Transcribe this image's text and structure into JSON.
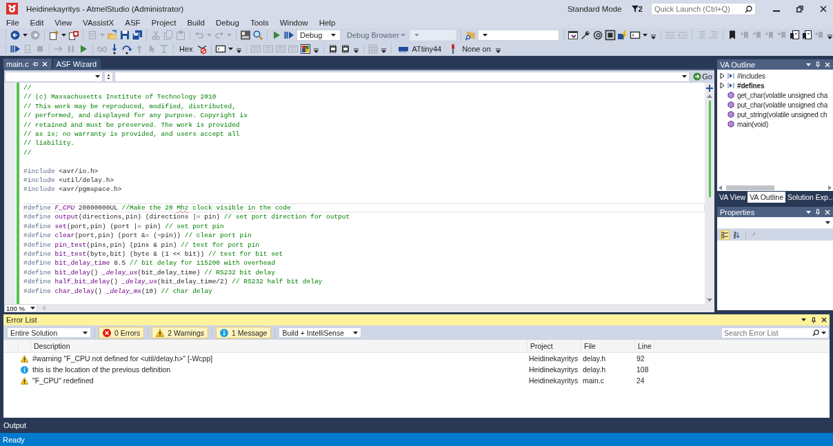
{
  "window": {
    "title": "Heidinekayritys - AtmelStudio (Administrator)",
    "mode": "Standard Mode",
    "notification_count": "2",
    "quick_launch": {
      "placeholder": "Quick Launch (Ctrl+Q)"
    }
  },
  "menu": [
    "File",
    "Edit",
    "View",
    "VAssistX",
    "ASF",
    "Project",
    "Build",
    "Debug",
    "Tools",
    "Window",
    "Help"
  ],
  "toolbar": {
    "dropdowns": [
      {
        "value": "Debug",
        "disabled": false
      },
      {
        "value": "Debug Browser",
        "disabled": true
      },
      {
        "disabled": true
      },
      {
        "disabled": false
      }
    ],
    "hex_label": "Hex",
    "device": "ATtiny44",
    "tool": "None on"
  },
  "editor": {
    "tabs": [
      {
        "label": "main.c",
        "selected": true
      },
      {
        "label": "ASF Wizard",
        "selected": false
      }
    ],
    "go_label": "Go",
    "zoom": "100 %",
    "lines": [
      {
        "current": false,
        "segments": [
          {
            "kind": "comment",
            "text": "//"
          }
        ]
      },
      {
        "current": false,
        "segments": [
          {
            "kind": "comment",
            "text": "// (c) Massachusetts Institute of Technology 2010"
          }
        ]
      },
      {
        "current": false,
        "segments": [
          {
            "kind": "comment",
            "text": "// This work may be reproduced, modified, distributed,"
          }
        ]
      },
      {
        "current": false,
        "segments": [
          {
            "kind": "comment",
            "text": "// performed, and displayed for any purpose. Copyright is"
          }
        ]
      },
      {
        "current": false,
        "segments": [
          {
            "kind": "comment",
            "text": "// retained and must be preserved. The work is provided"
          }
        ]
      },
      {
        "current": false,
        "segments": [
          {
            "kind": "comment",
            "text": "// as is; no warranty is provided, and users accept all"
          }
        ]
      },
      {
        "current": false,
        "segments": [
          {
            "kind": "comment",
            "text": "// liability."
          }
        ]
      },
      {
        "current": false,
        "segments": [
          {
            "kind": "comment",
            "text": "//"
          }
        ]
      },
      {
        "current": false
      },
      {
        "current": false,
        "segments": [
          {
            "kind": "directive",
            "text": "#include"
          },
          {
            "kind": "text",
            "text": " <avr/io.h>"
          }
        ]
      },
      {
        "current": false,
        "segments": [
          {
            "kind": "directive",
            "text": "#include"
          },
          {
            "kind": "text",
            "text": " <util/delay.h>"
          }
        ]
      },
      {
        "current": false,
        "segments": [
          {
            "kind": "directive",
            "text": "#include"
          },
          {
            "kind": "text",
            "text": " <avr/pgmspace.h>"
          }
        ]
      },
      {
        "current": false
      },
      {
        "current": true,
        "segments": [
          {
            "kind": "directive",
            "text": "#define "
          },
          {
            "kind": "macro-italic",
            "text": "F_CPU"
          },
          {
            "kind": "text",
            "text": " 20000000UL "
          },
          {
            "kind": "comment",
            "text": "//Make the 20 "
          },
          {
            "kind": "misspelled",
            "text": "Mhz"
          },
          {
            "kind": "comment",
            "text": " clock visible in the code"
          }
        ]
      },
      {
        "current": false,
        "segments": [
          {
            "kind": "directive",
            "text": "#define "
          },
          {
            "kind": "macro",
            "text": "output"
          },
          {
            "kind": "text",
            "text": "(directions,pin) (directions |= pin) "
          },
          {
            "kind": "comment",
            "text": "// set port direction for output"
          }
        ]
      },
      {
        "current": false,
        "segments": [
          {
            "kind": "directive",
            "text": "#define "
          },
          {
            "kind": "macro",
            "text": "set"
          },
          {
            "kind": "text",
            "text": "(port,pin) (port |= pin) "
          },
          {
            "kind": "comment",
            "text": "// set port pin"
          }
        ]
      },
      {
        "current": false,
        "segments": [
          {
            "kind": "directive",
            "text": "#define "
          },
          {
            "kind": "macro",
            "text": "clear"
          },
          {
            "kind": "text",
            "text": "(port,pin) (port &= (~pin)) "
          },
          {
            "kind": "comment",
            "text": "// clear port pin"
          }
        ]
      },
      {
        "current": false,
        "segments": [
          {
            "kind": "directive",
            "text": "#define "
          },
          {
            "kind": "macro",
            "text": "pin_test"
          },
          {
            "kind": "text",
            "text": "(pins,pin) (pins & pin) "
          },
          {
            "kind": "comment",
            "text": "// test for port pin"
          }
        ]
      },
      {
        "current": false,
        "segments": [
          {
            "kind": "directive",
            "text": "#define "
          },
          {
            "kind": "macro",
            "text": "bit_test"
          },
          {
            "kind": "text",
            "text": "(byte,bit) (byte & (1 << bit)) "
          },
          {
            "kind": "comment",
            "text": "// test for bit set"
          }
        ]
      },
      {
        "current": false,
        "segments": [
          {
            "kind": "directive",
            "text": "#define "
          },
          {
            "kind": "macro",
            "text": "bit_delay_time"
          },
          {
            "kind": "text",
            "text": " 8.5 "
          },
          {
            "kind": "comment",
            "text": "// bit delay for 115200 with overhead"
          }
        ]
      },
      {
        "current": false,
        "segments": [
          {
            "kind": "directive",
            "text": "#define "
          },
          {
            "kind": "macro",
            "text": "bit_delay"
          },
          {
            "kind": "text",
            "text": "() "
          },
          {
            "kind": "macro-italic",
            "text": "_delay_us"
          },
          {
            "kind": "text",
            "text": "(bit_delay_time) "
          },
          {
            "kind": "comment",
            "text": "// RS232 bit delay"
          }
        ]
      },
      {
        "current": false,
        "segments": [
          {
            "kind": "directive",
            "text": "#define "
          },
          {
            "kind": "macro",
            "text": "half_bit_delay"
          },
          {
            "kind": "text",
            "text": "() "
          },
          {
            "kind": "macro-italic",
            "text": "_delay_us"
          },
          {
            "kind": "text",
            "text": "(bit_delay_time/2) "
          },
          {
            "kind": "comment",
            "text": "// RS232 half bit delay"
          }
        ]
      },
      {
        "current": false,
        "segments": [
          {
            "kind": "directive",
            "text": "#define "
          },
          {
            "kind": "macro",
            "text": "char_delay"
          },
          {
            "kind": "text",
            "text": "() "
          },
          {
            "kind": "macro-italic",
            "text": "_delay_ms"
          },
          {
            "kind": "text",
            "text": "(10) "
          },
          {
            "kind": "comment",
            "text": "// char delay"
          }
        ]
      }
    ]
  },
  "va_outline": {
    "title": "VA Outline",
    "items": [
      {
        "kind": "group",
        "label": "#includes",
        "expanded": false,
        "bold": false
      },
      {
        "kind": "group",
        "label": "#defines",
        "expanded": false,
        "bold": true
      },
      {
        "kind": "function",
        "label": "get_char(volatile unsigned cha",
        "bold": false
      },
      {
        "kind": "function",
        "label": "put_char(volatile unsigned cha",
        "bold": false
      },
      {
        "kind": "function",
        "label": "put_string(volatile unsigned ch",
        "bold": false
      },
      {
        "kind": "function",
        "label": "main(void)",
        "bold": false
      }
    ],
    "tabs": [
      {
        "label": "VA View",
        "selected": false
      },
      {
        "label": "VA Outline",
        "selected": true
      },
      {
        "label": "Solution Exp...",
        "selected": false
      }
    ]
  },
  "properties": {
    "title": "Properties",
    "view_buttons": [
      {
        "kind": "categorized",
        "selected": true
      },
      {
        "kind": "alphabetical",
        "selected": false
      }
    ]
  },
  "error_list": {
    "title": "Error List",
    "scope": "Entire Solution",
    "filters": [
      {
        "kind": "error",
        "label": "0 Errors",
        "on": true
      },
      {
        "kind": "warning",
        "label": "2 Warnings",
        "on": true
      },
      {
        "kind": "message",
        "label": "1 Message",
        "on": true
      }
    ],
    "source": "Build + IntelliSense",
    "search": {
      "placeholder": "Search Error List"
    },
    "columns": [
      "Description",
      "Project",
      "File",
      "Line"
    ],
    "rows": [
      {
        "kind": "warning",
        "description": "#warning \"F_CPU not defined for <util/delay.h>\" [-Wcpp]",
        "project": "Heidinekayritys",
        "file": "delay.h",
        "line": "92"
      },
      {
        "kind": "message",
        "description": "this is the location of the previous definition",
        "project": "Heidinekayritys",
        "file": "delay.h",
        "line": "108"
      },
      {
        "kind": "warning",
        "description": "\"F_CPU\" redefined",
        "project": "Heidinekayritys",
        "file": "main.c",
        "line": "24"
      }
    ]
  },
  "output_tab": "Output",
  "status": "Ready"
}
